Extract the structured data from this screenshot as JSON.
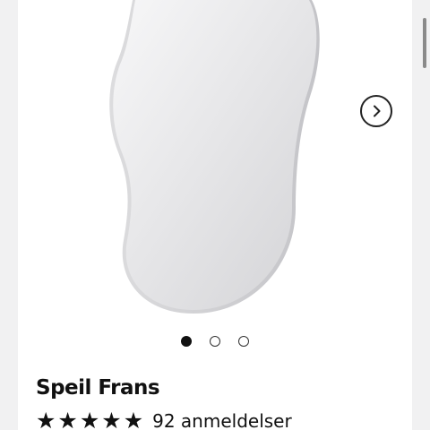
{
  "product": {
    "title": "Speil Frans",
    "image_alt": "Speil Frans",
    "rating": {
      "stars": 5,
      "max": 5,
      "reviews_label": "92 anmeldelser"
    }
  },
  "gallery": {
    "slide_count": 3,
    "active_index": 0,
    "next_icon": "chevron-right-icon"
  },
  "colors": {
    "background": "#f1f1f2",
    "card": "#ffffff",
    "text": "#111111"
  }
}
